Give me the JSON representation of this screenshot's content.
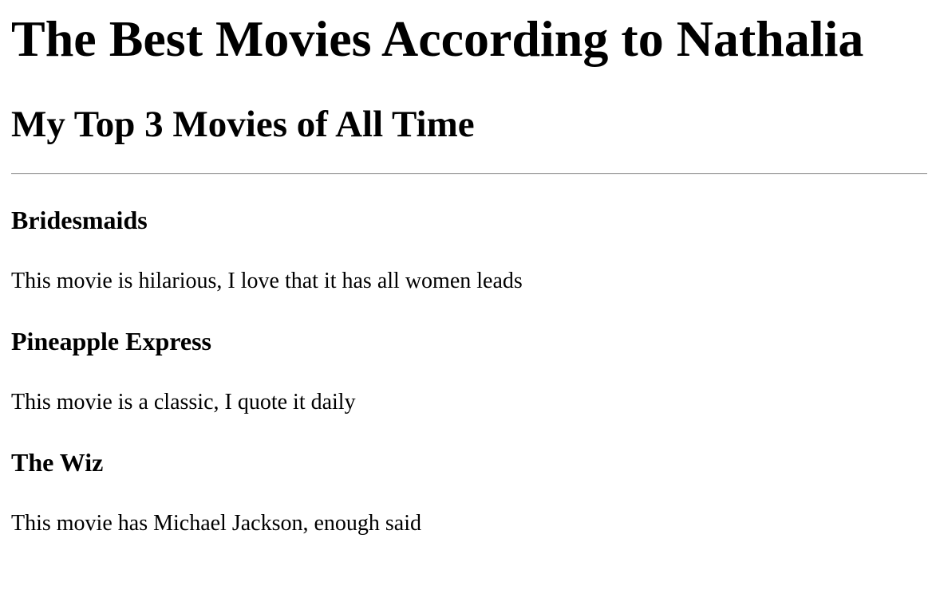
{
  "header": {
    "title": "The Best Movies According to Nathalia",
    "subtitle": "My Top 3 Movies of All Time"
  },
  "movies": [
    {
      "title": "Bridesmaids",
      "description": "This movie is hilarious, I love that it has all women leads"
    },
    {
      "title": "Pineapple Express",
      "description": "This movie is a classic, I quote it daily"
    },
    {
      "title": "The Wiz",
      "description": "This movie has Michael Jackson, enough said"
    }
  ]
}
